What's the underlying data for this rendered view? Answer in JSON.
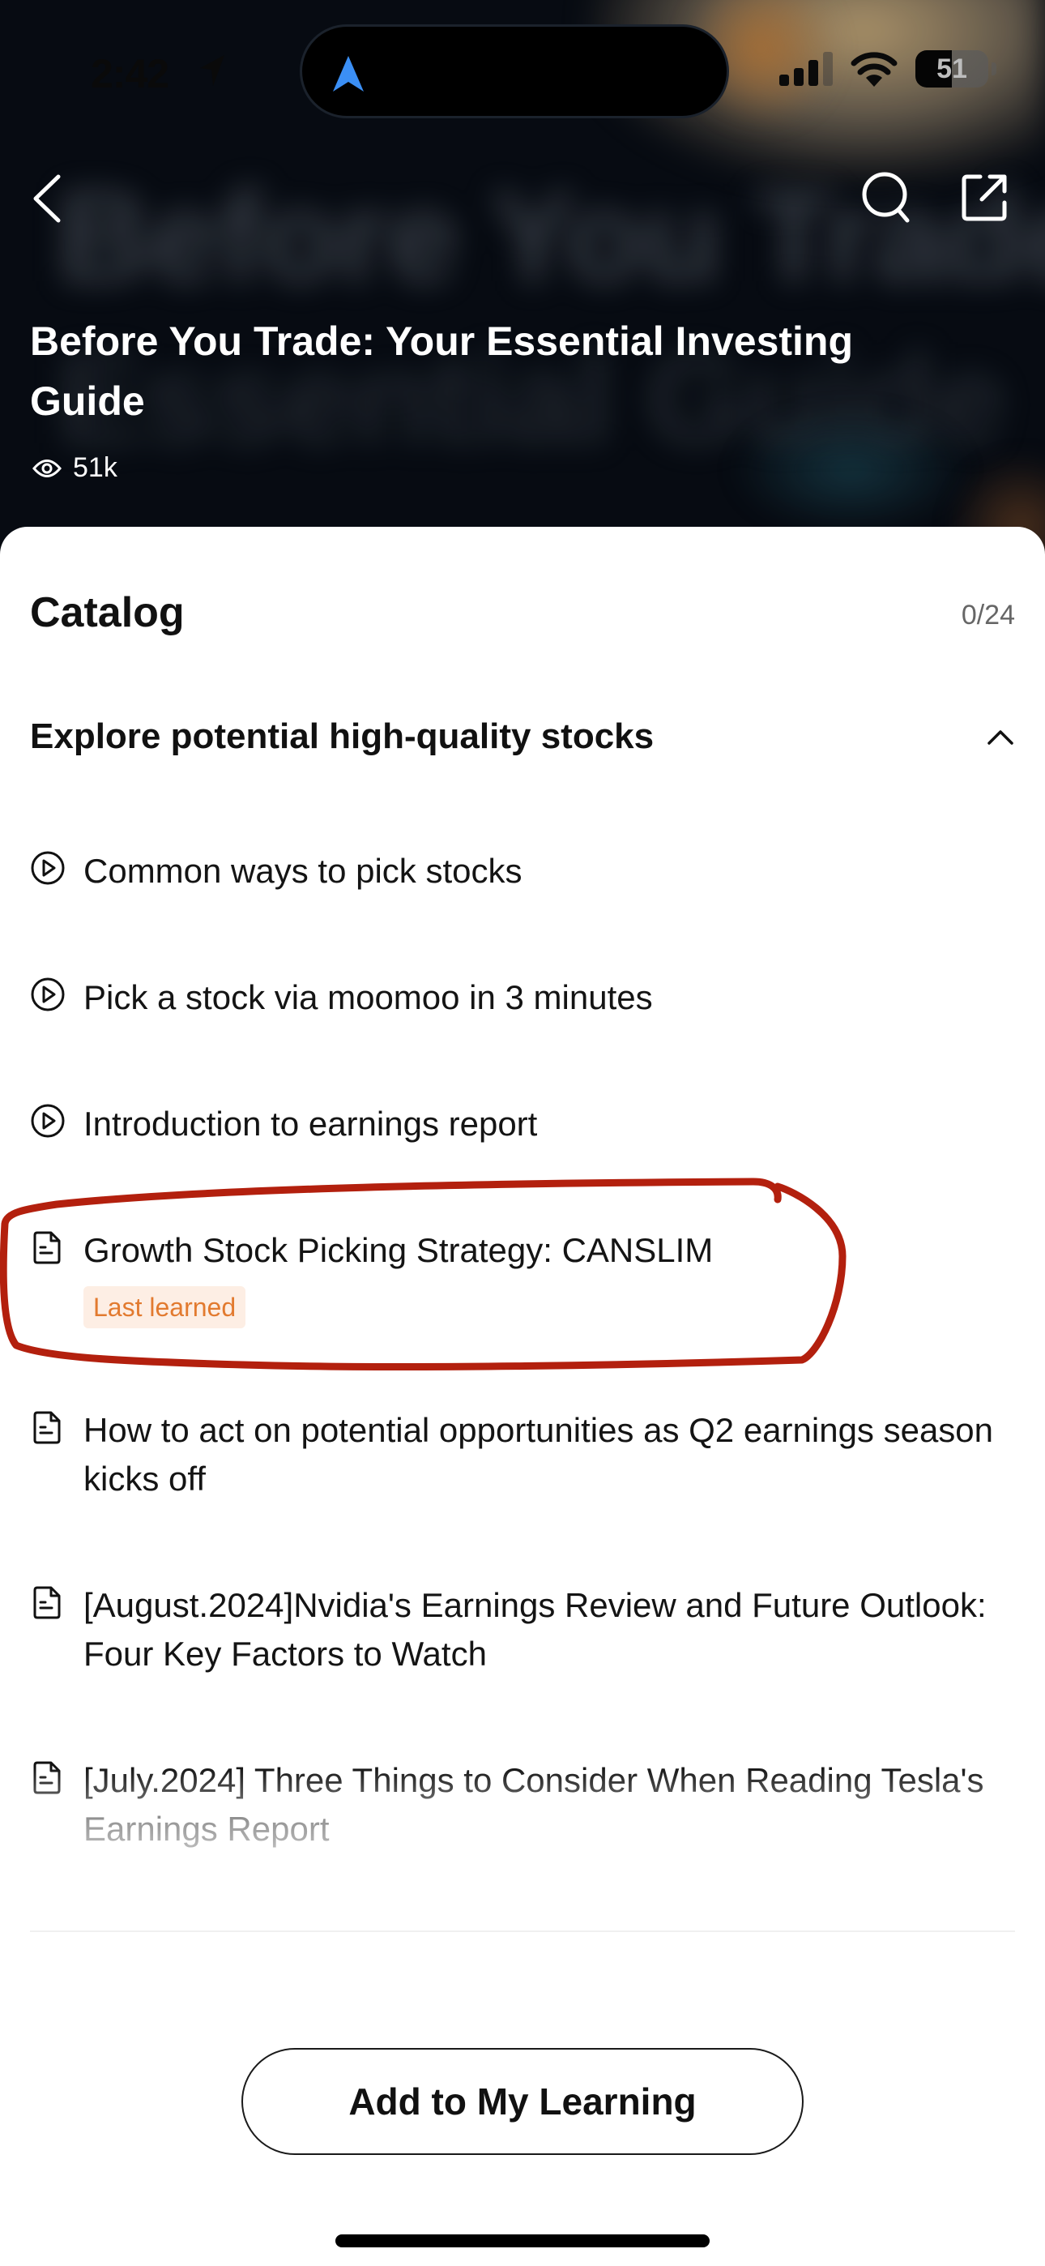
{
  "status_bar": {
    "time": "2:42",
    "battery": "51",
    "icons": [
      "location-arrow-icon",
      "navigation-arrow-icon",
      "cellular-signal-icon",
      "wifi-icon",
      "battery-icon"
    ]
  },
  "nav": {
    "back_icon": "chevron-left-icon",
    "search_icon": "search-icon",
    "share_icon": "share-icon"
  },
  "hero": {
    "title": "Before You Trade: Your Essential Investing Guide",
    "views": "51k",
    "background_text_1": "Before You Trade",
    "background_text_2": "Essential Guide"
  },
  "catalog": {
    "title": "Catalog",
    "progress": "0/24",
    "section": {
      "title": "Explore potential high-quality stocks",
      "expanded": true
    },
    "lessons": [
      {
        "type": "video",
        "icon": "play-circle-icon",
        "title": "Common ways to pick stocks"
      },
      {
        "type": "video",
        "icon": "play-circle-icon",
        "title": "Pick a stock via moomoo in 3 minutes"
      },
      {
        "type": "video",
        "icon": "play-circle-icon",
        "title": "Introduction to earnings report"
      },
      {
        "type": "article",
        "icon": "document-icon",
        "title": "Growth Stock Picking Strategy: CANSLIM",
        "badge": "Last learned",
        "annotated": true
      },
      {
        "type": "article",
        "icon": "document-icon",
        "title": "How to act on potential opportunities as Q2 earnings season kicks off"
      },
      {
        "type": "article",
        "icon": "document-icon",
        "title": "[August.2024]Nvidia's Earnings Review and Future Outlook: Four Key Factors to Watch"
      },
      {
        "type": "article",
        "icon": "document-icon",
        "title": "[July.2024] Three Things to Consider When Reading Tesla's Earnings Report"
      }
    ]
  },
  "footer": {
    "add_button": "Add to My Learning"
  },
  "colors": {
    "badge_text": "#e27a2f",
    "badge_bg": "#fdeee4",
    "annotation": "#b3200e",
    "island_arrow": "#3b8ff5"
  }
}
